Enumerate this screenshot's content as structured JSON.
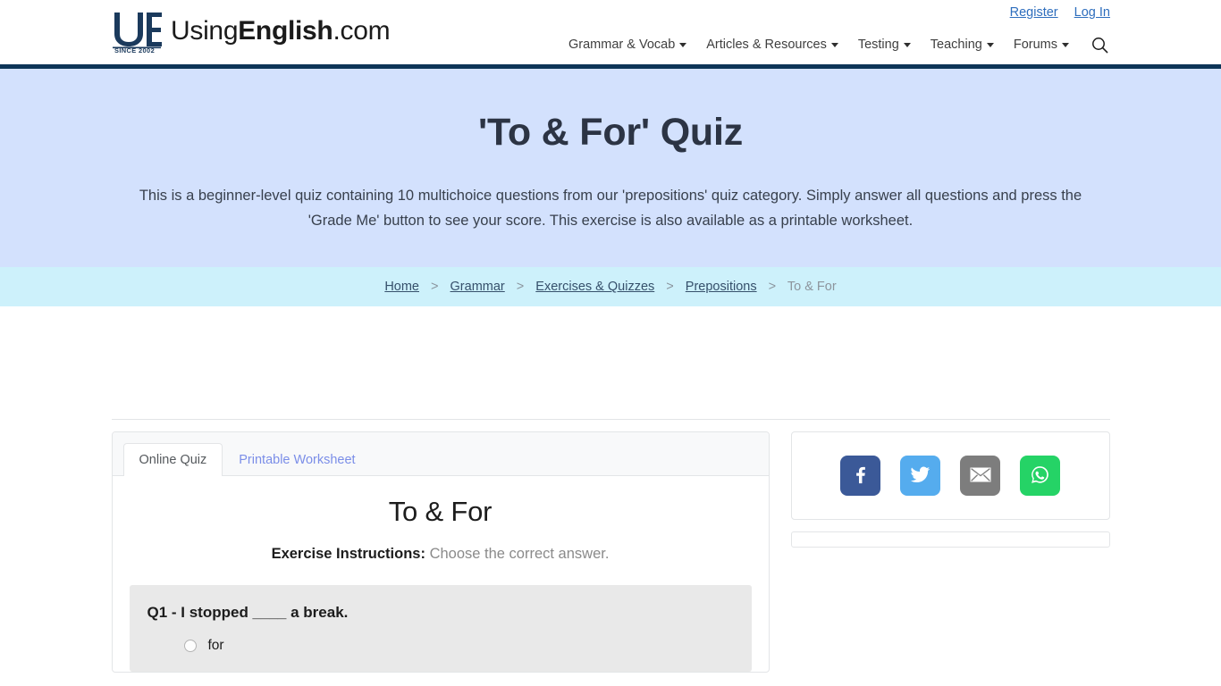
{
  "header": {
    "brand": {
      "prefix": "Using",
      "bold": "English",
      "suffix": ".com",
      "mark_initials": "UE",
      "mark_since": "SINCE 2002"
    },
    "auth": [
      {
        "label": "Register",
        "name": "register-link"
      },
      {
        "label": "Log In",
        "name": "login-link"
      }
    ],
    "nav": [
      {
        "label": "Grammar & Vocab",
        "has_caret": true
      },
      {
        "label": "Articles & Resources",
        "has_caret": true
      },
      {
        "label": "Testing",
        "has_caret": true
      },
      {
        "label": "Teaching",
        "has_caret": true
      },
      {
        "label": "Forums",
        "has_caret": true
      }
    ],
    "search_icon": "search-icon",
    "rule_color": "#0d3557"
  },
  "hero": {
    "title": "'To & For' Quiz",
    "description": "This is a beginner-level quiz containing 10 multichoice questions from our 'prepositions' quiz category. Simply answer all questions and press the 'Grade Me' button to see your score. This exercise is also available as a printable worksheet.",
    "bg_color": "#d3e1fd"
  },
  "breadcrumb": {
    "bg_color": "#cdf1fb",
    "separator": ">",
    "items": [
      {
        "label": "Home",
        "link": true
      },
      {
        "label": "Grammar",
        "link": true
      },
      {
        "label": "Exercises & Quizzes",
        "link": true
      },
      {
        "label": "Prepositions",
        "link": true
      },
      {
        "label": "To & For",
        "link": false
      }
    ]
  },
  "main": {
    "tabs": [
      {
        "label": "Online Quiz",
        "active": true
      },
      {
        "label": "Printable Worksheet",
        "active": false
      }
    ],
    "quiz": {
      "title": "To & For",
      "instructions_label": "Exercise Instructions:",
      "instructions_text": "Choose the correct answer.",
      "questions": [
        {
          "text": "Q1 - I stopped ____ a break.",
          "options": [
            {
              "label": "for",
              "selected": false
            }
          ]
        }
      ]
    }
  },
  "sidebar": {
    "share_buttons": [
      {
        "name": "facebook-share-button",
        "icon": "facebook-icon",
        "color": "#3b5998"
      },
      {
        "name": "twitter-share-button",
        "icon": "twitter-icon",
        "color": "#55acee"
      },
      {
        "name": "email-share-button",
        "icon": "email-icon",
        "color": "#7d7d7d"
      },
      {
        "name": "whatsapp-share-button",
        "icon": "whatsapp-icon",
        "color": "#25d366"
      }
    ]
  }
}
